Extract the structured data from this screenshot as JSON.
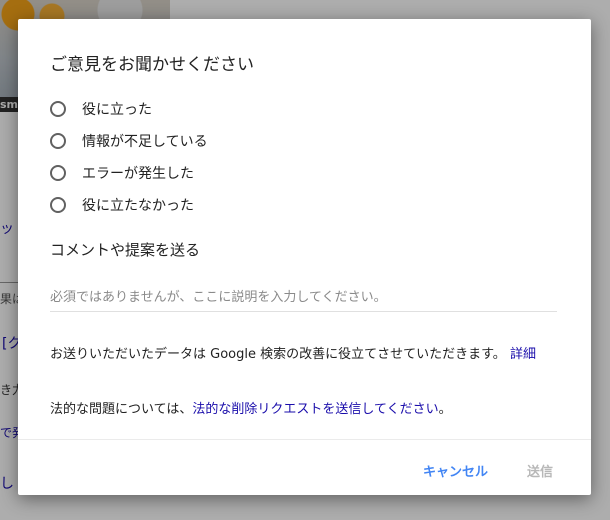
{
  "background": {
    "caption": "sm.",
    "fragments": [
      "ット",
      "果は",
      "[ク",
      "き力",
      "で発",
      "し"
    ]
  },
  "dialog": {
    "title": "ご意見をお聞かせください",
    "options": [
      {
        "label": "役に立った",
        "selected": false
      },
      {
        "label": "情報が不足している",
        "selected": false
      },
      {
        "label": "エラーが発生した",
        "selected": false
      },
      {
        "label": "役に立たなかった",
        "selected": false
      }
    ],
    "comment_heading": "コメントや提案を送る",
    "comment_placeholder": "必須ではありませんが、ここに説明を入力してください。",
    "info_text": "お送りいただいたデータは Google 検索の改善に役立てさせていただきます。",
    "info_link": "詳細",
    "legal_prefix": "法的な問題については、",
    "legal_link": "法的な削除リクエストを送信してください",
    "legal_suffix": "。",
    "cancel_label": "キャンセル",
    "submit_label": "送信",
    "colors": {
      "link": "#1a0dab",
      "cancel": "#4285f4",
      "submit_disabled": "#b8b8b8"
    }
  }
}
